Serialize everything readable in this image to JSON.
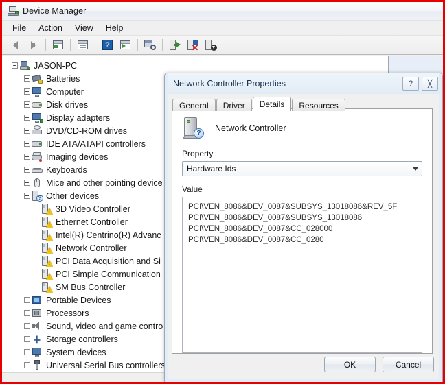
{
  "window": {
    "title": "Device Manager",
    "icon": "mmc-console-icon"
  },
  "menubar": {
    "items": [
      {
        "label": "File"
      },
      {
        "label": "Action"
      },
      {
        "label": "View"
      },
      {
        "label": "Help"
      }
    ]
  },
  "toolbar": {
    "buttons": [
      {
        "icon": "back-arrow-icon"
      },
      {
        "icon": "forward-arrow-icon"
      },
      {
        "icon": "show-hide-console-tree-icon"
      },
      {
        "icon": "properties-icon"
      },
      {
        "icon": "help-icon"
      },
      {
        "icon": "show-hide-action-pane-icon"
      },
      {
        "icon": "scan-for-hardware-changes-icon"
      },
      {
        "icon": "update-driver-software-icon"
      },
      {
        "icon": "disable-device-icon"
      },
      {
        "icon": "uninstall-device-icon"
      }
    ]
  },
  "tree": {
    "root": {
      "label": "JASON-PC",
      "icon": "computer-root-icon",
      "expanded": true
    },
    "nodes": [
      {
        "label": "Batteries",
        "icon": "battery-icon",
        "level": 1,
        "expandable": true,
        "expanded": false
      },
      {
        "label": "Computer",
        "icon": "computer-icon",
        "level": 1,
        "expandable": true,
        "expanded": false
      },
      {
        "label": "Disk drives",
        "icon": "disk-drive-icon",
        "level": 1,
        "expandable": true,
        "expanded": false
      },
      {
        "label": "Display adapters",
        "icon": "display-adapter-icon",
        "level": 1,
        "expandable": true,
        "expanded": false
      },
      {
        "label": "DVD/CD-ROM drives",
        "icon": "dvd-drive-icon",
        "level": 1,
        "expandable": true,
        "expanded": false
      },
      {
        "label": "IDE ATA/ATAPI controllers",
        "icon": "ide-controller-icon",
        "level": 1,
        "expandable": true,
        "expanded": false
      },
      {
        "label": "Imaging devices",
        "icon": "imaging-device-icon",
        "level": 1,
        "expandable": true,
        "expanded": false
      },
      {
        "label": "Keyboards",
        "icon": "keyboard-icon",
        "level": 1,
        "expandable": true,
        "expanded": false
      },
      {
        "label": "Mice and other pointing device",
        "icon": "mouse-icon",
        "level": 1,
        "expandable": true,
        "expanded": false
      },
      {
        "label": "Other devices",
        "icon": "unknown-device-icon",
        "level": 1,
        "expandable": true,
        "expanded": true
      },
      {
        "label": "3D Video Controller",
        "icon": "warning-device-icon",
        "level": 2,
        "expandable": false
      },
      {
        "label": "Ethernet Controller",
        "icon": "warning-device-icon",
        "level": 2,
        "expandable": false
      },
      {
        "label": "Intel(R) Centrino(R) Advanc",
        "icon": "warning-device-icon",
        "level": 2,
        "expandable": false
      },
      {
        "label": "Network Controller",
        "icon": "warning-device-icon",
        "level": 2,
        "expandable": false
      },
      {
        "label": "PCI Data Acquisition and Si",
        "icon": "warning-device-icon",
        "level": 2,
        "expandable": false
      },
      {
        "label": "PCI Simple Communication",
        "icon": "warning-device-icon",
        "level": 2,
        "expandable": false
      },
      {
        "label": "SM Bus Controller",
        "icon": "warning-device-icon",
        "level": 2,
        "expandable": false
      },
      {
        "label": "Portable Devices",
        "icon": "portable-device-icon",
        "level": 1,
        "expandable": true,
        "expanded": false
      },
      {
        "label": "Processors",
        "icon": "processor-icon",
        "level": 1,
        "expandable": true,
        "expanded": false
      },
      {
        "label": "Sound, video and game contro",
        "icon": "sound-device-icon",
        "level": 1,
        "expandable": true,
        "expanded": false
      },
      {
        "label": "Storage controllers",
        "icon": "storage-controller-icon",
        "level": 1,
        "expandable": true,
        "expanded": false
      },
      {
        "label": "System devices",
        "icon": "system-device-icon",
        "level": 1,
        "expandable": true,
        "expanded": false
      },
      {
        "label": "Universal Serial Bus controllers",
        "icon": "usb-controller-icon",
        "level": 1,
        "expandable": true,
        "expanded": false
      }
    ]
  },
  "dialog": {
    "title": "Network Controller Properties",
    "help_button": "?",
    "close_button": "╳",
    "tabs": [
      {
        "label": "General",
        "active": false
      },
      {
        "label": "Driver",
        "active": false
      },
      {
        "label": "Details",
        "active": true
      },
      {
        "label": "Resources",
        "active": false
      }
    ],
    "device": {
      "name": "Network Controller",
      "icon": "unknown-device-large-icon",
      "badge": "?"
    },
    "property": {
      "label": "Property",
      "selected": "Hardware Ids",
      "dropdown_icon": "chevron-down-icon"
    },
    "value": {
      "label": "Value",
      "lines": [
        "PCI\\VEN_8086&DEV_0087&SUBSYS_13018086&REV_5F",
        "PCI\\VEN_8086&DEV_0087&SUBSYS_13018086",
        "PCI\\VEN_8086&DEV_0087&CC_028000",
        "PCI\\VEN_8086&DEV_0087&CC_0280"
      ]
    },
    "buttons": {
      "ok": "OK",
      "cancel": "Cancel"
    }
  },
  "colors": {
    "annotation_border": "#e60000",
    "warning": "#f0c419",
    "dialog_frame": "#e3edf7",
    "tree_background": "#ffffff"
  }
}
